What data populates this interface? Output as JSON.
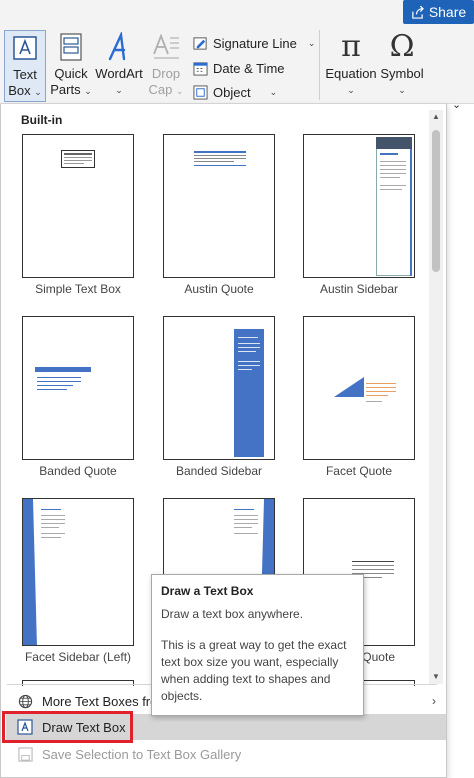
{
  "ribbon": {
    "share_label": "Share",
    "text_box": {
      "line1": "Text",
      "line2": "Box"
    },
    "quick_parts": {
      "line1": "Quick",
      "line2": "Parts"
    },
    "wordart": {
      "line1": "WordArt"
    },
    "drop_cap": {
      "line1": "Drop",
      "line2": "Cap"
    },
    "signature_line": "Signature Line",
    "date_time": "Date & Time",
    "object": "Object",
    "equation": "Equation",
    "symbol": "Symbol",
    "equation_glyph": "π",
    "symbol_glyph": "Ω"
  },
  "gallery": {
    "section_header": "Built-in",
    "items": [
      {
        "label": "Simple Text Box"
      },
      {
        "label": "Austin Quote"
      },
      {
        "label": "Austin Sidebar"
      },
      {
        "label": "Banded Quote"
      },
      {
        "label": "Banded Sidebar"
      },
      {
        "label": "Facet Quote"
      },
      {
        "label": "Facet Sidebar (Left)"
      },
      {
        "label": ""
      },
      {
        "label": "Quote"
      }
    ]
  },
  "menu": {
    "more_text_boxes": "More Text Boxes from",
    "draw_text_box": "Draw Text Box",
    "save_selection": "Save Selection to Text Box Gallery"
  },
  "tooltip": {
    "title": "Draw a Text Box",
    "line1": "Draw a text box anywhere.",
    "line2": "This is a great way to get the exact text box size you want, especially when adding text to shapes and objects."
  },
  "colors": {
    "accent_blue": "#4472c4",
    "share_blue": "#1f63b8",
    "highlight_red": "#e0202a",
    "facet_orange": "#e8a060"
  }
}
